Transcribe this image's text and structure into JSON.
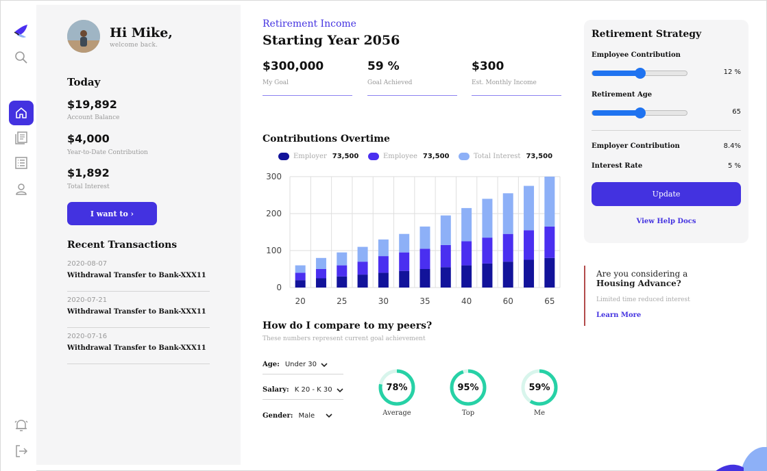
{
  "user": {
    "greeting": "Hi Mike,",
    "welcome": "welcome back."
  },
  "today": {
    "title": "Today",
    "stats": [
      {
        "value": "$19,892",
        "label": "Account Balance"
      },
      {
        "value": "$4,000",
        "label": "Year-to-Date Contribution"
      },
      {
        "value": "$1,892",
        "label": "Total Interest"
      }
    ],
    "action_label": "I want to ›"
  },
  "transactions": {
    "title": "Recent Transactions",
    "items": [
      {
        "date": "2020-08-07",
        "text": "Withdrawal Transfer to Bank-XXX11"
      },
      {
        "date": "2020-07-21",
        "text": "Withdrawal Transfer to Bank-XXX11"
      },
      {
        "date": "2020-07-16",
        "text": "Withdrawal Transfer to Bank-XXX11"
      }
    ]
  },
  "header": {
    "label": "Retirement Income",
    "title": "Starting Year 2056"
  },
  "metrics": [
    {
      "value": "$300,000",
      "label": "My Goal"
    },
    {
      "value": "59 %",
      "label": "Goal Achieved"
    },
    {
      "value": "$300",
      "label": "Est. Monthly Income"
    }
  ],
  "legend": [
    {
      "name": "Employer",
      "value": "73,500",
      "color": "#12139a"
    },
    {
      "name": "Employee",
      "value": "73,500",
      "color": "#4a2ff0"
    },
    {
      "name": "Total Interest",
      "value": "73,500",
      "color": "#8db0f7"
    }
  ],
  "chart_data": {
    "type": "bar",
    "title": "Contributions Overtime",
    "stacked": true,
    "categories": [
      "20",
      "",
      "25",
      "",
      "30",
      "",
      "35",
      "",
      "40",
      "",
      "60",
      "",
      "65"
    ],
    "series": [
      {
        "name": "Employer",
        "values": [
          20,
          25,
          30,
          35,
          40,
          45,
          50,
          55,
          60,
          65,
          70,
          75,
          80
        ]
      },
      {
        "name": "Employee",
        "values": [
          20,
          25,
          30,
          35,
          45,
          50,
          55,
          60,
          65,
          70,
          75,
          80,
          85
        ]
      },
      {
        "name": "Total Interest",
        "values": [
          20,
          30,
          35,
          40,
          45,
          50,
          60,
          80,
          90,
          105,
          110,
          120,
          135
        ]
      }
    ],
    "yticks": [
      0,
      100,
      200,
      300
    ],
    "ylim": [
      0,
      300
    ],
    "grid": true,
    "colors": [
      "#12139a",
      "#4a2ff0",
      "#8db0f7"
    ]
  },
  "peers": {
    "title": "How do I compare to my peers?",
    "subtitle": "These numbers represent current goal achievement",
    "filters": [
      {
        "label": "Age:",
        "value": "Under 30"
      },
      {
        "label": "Salary:",
        "value": "K 20 - K 30"
      },
      {
        "label": "Gender:",
        "value": "Male"
      }
    ],
    "rings": [
      {
        "percent": 78,
        "text": "78%",
        "label": "Average"
      },
      {
        "percent": 95,
        "text": "95%",
        "label": "Top"
      },
      {
        "percent": 59,
        "text": "59%",
        "label": "Me"
      }
    ],
    "ring_color": "#27d1a6",
    "ring_track": "#d8f5ec"
  },
  "strategy": {
    "title": "Retirement Strategy",
    "employee_contribution": {
      "label": "Employee Contribution",
      "value": "12 %",
      "fraction": 0.5
    },
    "retirement_age": {
      "label": "Retirement Age",
      "value": "65",
      "fraction": 0.5
    },
    "employer_contribution": {
      "label": "Employer Contribution",
      "value": "8.4%"
    },
    "interest_rate": {
      "label": "Interest Rate",
      "value": "5 %"
    },
    "update_label": "Update",
    "help_label": "View Help Docs"
  },
  "promo": {
    "line1": "Are you considering a",
    "line2": "Housing Advance?",
    "note": "Limited time reduced interest",
    "link": "Learn More"
  },
  "accent": "#4332e0"
}
